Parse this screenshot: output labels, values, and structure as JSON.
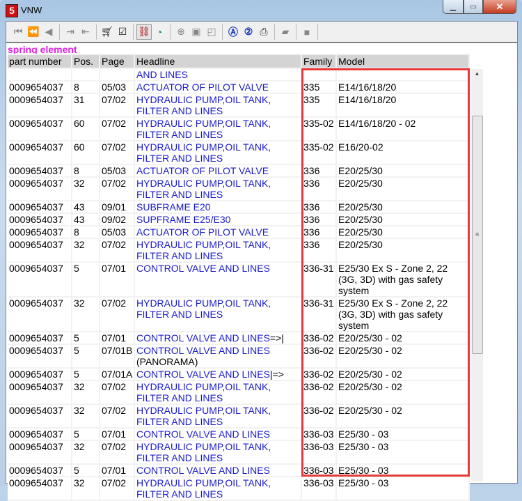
{
  "window": {
    "title": "VNW",
    "icon": "app-logo-icon",
    "controls": [
      "minimize",
      "maximize",
      "close"
    ]
  },
  "toolbar": {
    "buttons": [
      "first-icon",
      "rewind-icon",
      "previous-icon",
      "export-icon",
      "import-icon",
      "cart-icon",
      "checklist-icon",
      "link-icon",
      "clock-icon",
      "zoom-in-icon",
      "page-icon",
      "page-fold-icon",
      "search-a-icon",
      "search-2-icon",
      "print-icon",
      "stamp-icon",
      "stop-icon"
    ]
  },
  "section_title": "spring element",
  "columns": [
    "part number",
    "Pos.",
    "Page",
    "Headline",
    "Family",
    "Model"
  ],
  "partial_row": {
    "headline": "AND LINES"
  },
  "rows": [
    {
      "part": "0009654037",
      "pos": "8",
      "page": "05/03",
      "headline": "ACTUATOR OF PILOT VALVE",
      "suffix": "",
      "family": "335",
      "model": "E14/16/18/20"
    },
    {
      "part": "0009654037",
      "pos": "31",
      "page": "07/02",
      "headline": "HYDRAULIC PUMP,OIL TANK,  FILTER AND LINES",
      "suffix": "",
      "family": "335",
      "model": "E14/16/18/20"
    },
    {
      "part": "0009654037",
      "pos": "60",
      "page": "07/02",
      "headline": "HYDRAULIC PUMP,OIL TANK,  FILTER AND LINES",
      "suffix": "",
      "family": "335-02",
      "model": "E14/16/18/20 - 02"
    },
    {
      "part": "0009654037",
      "pos": "60",
      "page": "07/02",
      "headline": "HYDRAULIC PUMP,OIL TANK,  FILTER AND LINES",
      "suffix": "",
      "family": "335-02",
      "model": "E16/20-02"
    },
    {
      "part": "0009654037",
      "pos": "8",
      "page": "05/03",
      "headline": "ACTUATOR OF PILOT VALVE",
      "suffix": "",
      "family": "336",
      "model": "E20/25/30"
    },
    {
      "part": "0009654037",
      "pos": "32",
      "page": "07/02",
      "headline": "HYDRAULIC PUMP,OIL TANK,  FILTER AND LINES",
      "suffix": "",
      "family": "336",
      "model": "E20/25/30"
    },
    {
      "part": "0009654037",
      "pos": "43",
      "page": "09/01",
      "headline": "SUBFRAME E20",
      "suffix": "",
      "family": "336",
      "model": "E20/25/30"
    },
    {
      "part": "0009654037",
      "pos": "43",
      "page": "09/02",
      "headline": "SUPFRAME E25/E30",
      "suffix": "",
      "family": "336",
      "model": "E20/25/30"
    },
    {
      "part": "0009654037",
      "pos": "8",
      "page": "05/03",
      "headline": "ACTUATOR OF PILOT VALVE",
      "suffix": "",
      "family": "336",
      "model": "E20/25/30"
    },
    {
      "part": "0009654037",
      "pos": "32",
      "page": "07/02",
      "headline": "HYDRAULIC PUMP,OIL TANK,  FILTER AND LINES",
      "suffix": "",
      "family": "336",
      "model": "E20/25/30"
    },
    {
      "part": "0009654037",
      "pos": "5",
      "page": "07/01",
      "headline": "CONTROL VALVE AND LINES",
      "suffix": "",
      "family": "336-31",
      "model": "E25/30 Ex S - Zone 2, 22 (3G, 3D) with gas safety system"
    },
    {
      "part": "0009654037",
      "pos": "32",
      "page": "07/02",
      "headline": "HYDRAULIC PUMP,OIL TANK,  FILTER AND LINES",
      "suffix": "",
      "family": "336-31",
      "model": "E25/30 Ex S - Zone 2, 22 (3G, 3D) with gas safety system"
    },
    {
      "part": "0009654037",
      "pos": "5",
      "page": "07/01",
      "headline": "CONTROL VALVE AND LINES",
      "suffix": "=>|",
      "family": "336-02",
      "model": "E20/25/30 - 02"
    },
    {
      "part": "0009654037",
      "pos": "5",
      "page": "07/01B",
      "headline": "CONTROL VALVE AND LINES",
      "suffix": " (PANORAMA)",
      "family": "336-02",
      "model": "E20/25/30 - 02"
    },
    {
      "part": "0009654037",
      "pos": "5",
      "page": "07/01A",
      "headline": "CONTROL VALVE AND LINES",
      "suffix": "|=>",
      "family": "336-02",
      "model": "E20/25/30 - 02"
    },
    {
      "part": "0009654037",
      "pos": "32",
      "page": "07/02",
      "headline": "HYDRAULIC PUMP,OIL TANK,  FILTER AND LINES",
      "suffix": "",
      "family": "336-02",
      "model": "E20/25/30 - 02"
    },
    {
      "part": "0009654037",
      "pos": "32",
      "page": "07/02",
      "headline": "HYDRAULIC PUMP,OIL TANK,  FILTER AND LINES",
      "suffix": "",
      "family": "336-02",
      "model": "E20/25/30 - 02"
    },
    {
      "part": "0009654037",
      "pos": "5",
      "page": "07/01",
      "headline": "CONTROL VALVE AND LINES",
      "suffix": "",
      "family": "336-03",
      "model": "E25/30 - 03"
    },
    {
      "part": "0009654037",
      "pos": "32",
      "page": "07/02",
      "headline": "HYDRAULIC PUMP,OIL TANK,  FILTER AND LINES",
      "suffix": "",
      "family": "336-03",
      "model": "E25/30 - 03"
    },
    {
      "part": "0009654037",
      "pos": "5",
      "page": "07/01",
      "headline": "CONTROL VALVE AND LINES",
      "suffix": "",
      "family": "336-03",
      "model": "E25/30 - 03"
    },
    {
      "part": "0009654037",
      "pos": "32",
      "page": "07/02",
      "headline": "HYDRAULIC PUMP,OIL TANK,  FILTER AND LINES",
      "suffix": "",
      "family": "336-03",
      "model": "E25/30 - 03"
    }
  ],
  "colors": {
    "section_title": "#e020e0",
    "headline_link": "#1a1acc",
    "highlight_box": "#e83a3a"
  }
}
